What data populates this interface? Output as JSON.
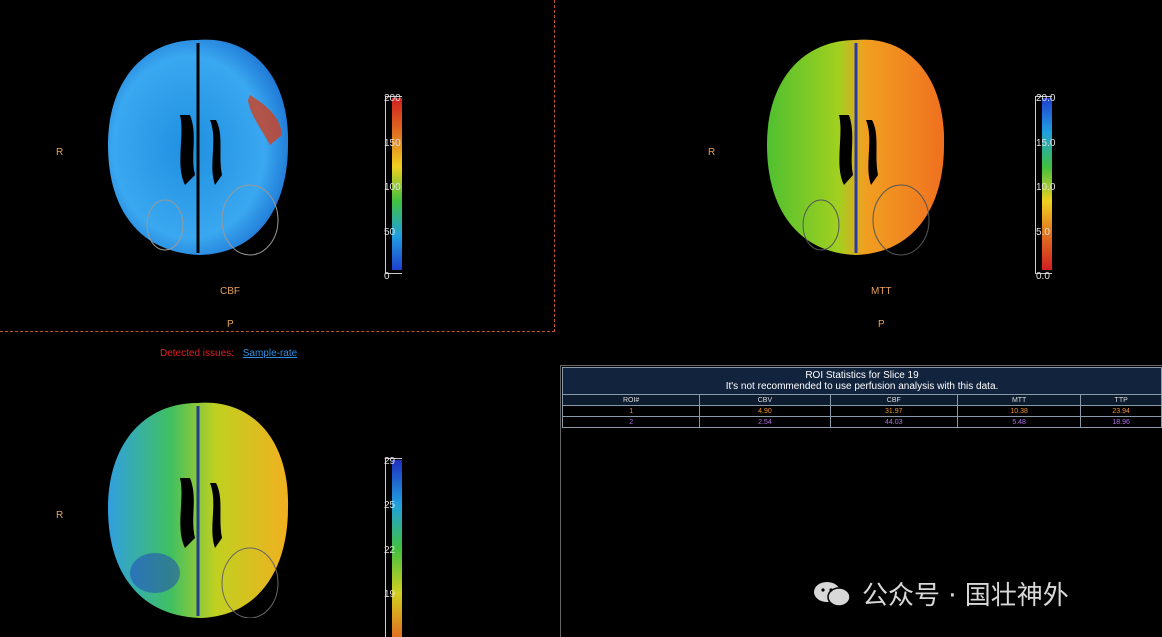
{
  "viewports": {
    "cbf": {
      "orient_left": "R",
      "orient_bottom": "P",
      "map_label": "CBF",
      "scale_ticks": [
        "200",
        "150",
        "100",
        "50",
        "0"
      ]
    },
    "mtt": {
      "orient_left": "R",
      "orient_bottom": "P",
      "map_label": "MTT",
      "scale_ticks": [
        "20.0",
        "15.0",
        "10.0",
        "5.0",
        "0.0"
      ]
    },
    "ttp": {
      "orient_left": "R",
      "scale_ticks": [
        "29",
        "25",
        "22",
        "19"
      ]
    }
  },
  "issues": {
    "label": "Detected issues:",
    "link": "Sample-rate"
  },
  "roi": {
    "title": "ROI Statistics for Slice 19",
    "subtitle": "It's not recommended to use perfusion analysis with this data.",
    "columns": [
      "ROI#",
      "CBV",
      "CBF",
      "MTT",
      "TTP"
    ],
    "rows": [
      {
        "values": [
          "1",
          "4.90",
          "31.97",
          "10.38",
          "23.94"
        ],
        "color": "#f0952a"
      },
      {
        "values": [
          "2",
          "2.54",
          "44.03",
          "5.48",
          "18.96"
        ],
        "color": "#b06ae8"
      }
    ]
  },
  "watermark": {
    "text": "公众号 · 国壮神外",
    "icon": "chat-bubbles-icon"
  },
  "colors": {
    "orient": "#e6a15a",
    "issue_red": "#e02020",
    "link_blue": "#2f8fe0",
    "table_header_bg": "#12233d"
  }
}
